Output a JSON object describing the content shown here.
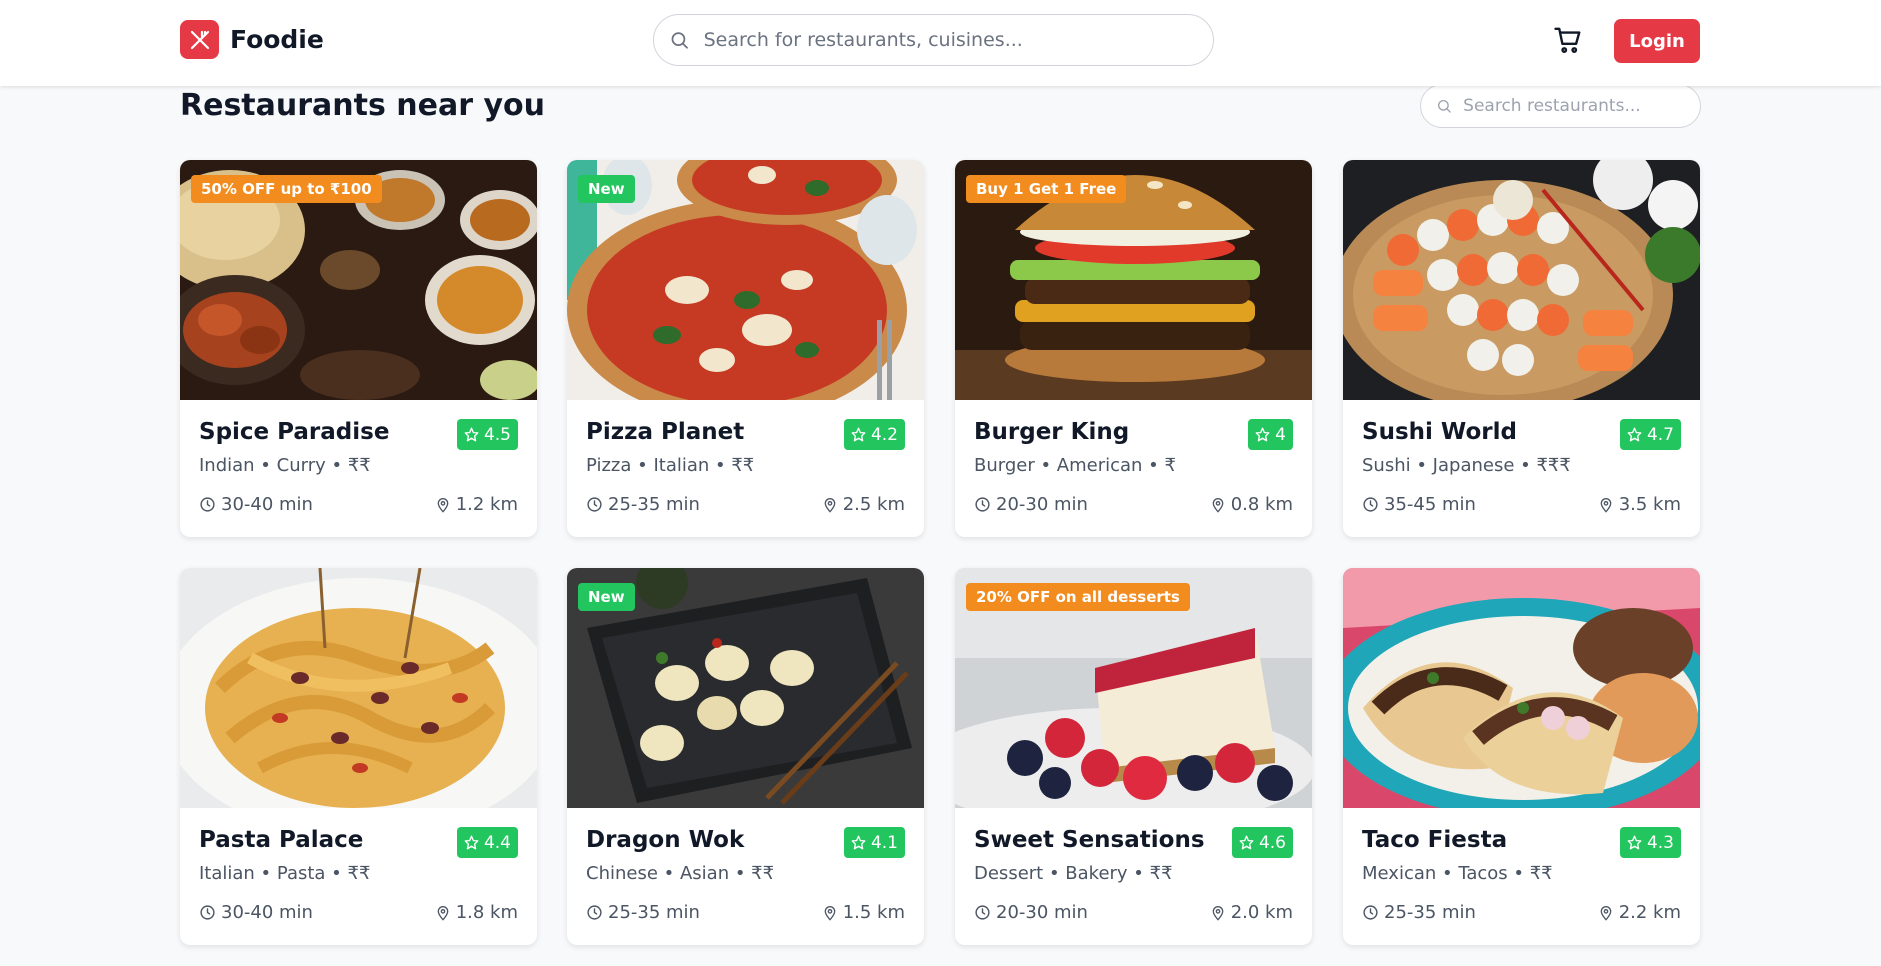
{
  "brand": {
    "name": "Foodie",
    "color": "#e63946"
  },
  "header": {
    "search_placeholder": "Search for restaurants, cuisines...",
    "cart_icon": "cart-icon",
    "login_label": "Login"
  },
  "section": {
    "title": "Restaurants near you",
    "search_placeholder": "Search restaurants..."
  },
  "colors": {
    "accent": "#e63946",
    "rating": "#22c55e",
    "offer_badge": "#f28c1f",
    "new_badge": "#22c55e"
  },
  "restaurants": [
    {
      "name": "Spice Paradise",
      "rating": "4.5",
      "cuisine": "Indian • Curry • ₹₹",
      "time": "30-40 min",
      "distance": "1.2 km",
      "badge": "50% OFF up to ₹100",
      "badge_type": "offer",
      "image": "indian-curry-spread"
    },
    {
      "name": "Pizza Planet",
      "rating": "4.2",
      "cuisine": "Pizza • Italian • ₹₹",
      "time": "25-35 min",
      "distance": "2.5 km",
      "badge": "New",
      "badge_type": "new",
      "image": "margherita-pizza"
    },
    {
      "name": "Burger King",
      "rating": "4",
      "cuisine": "Burger • American • ₹",
      "time": "20-30 min",
      "distance": "0.8 km",
      "badge": "Buy 1 Get 1 Free",
      "badge_type": "offer",
      "image": "burger"
    },
    {
      "name": "Sushi World",
      "rating": "4.7",
      "cuisine": "Sushi • Japanese • ₹₹₹",
      "time": "35-45 min",
      "distance": "3.5 km",
      "badge": "",
      "badge_type": "none",
      "image": "sushi-platter"
    },
    {
      "name": "Pasta Palace",
      "rating": "4.4",
      "cuisine": "Italian • Pasta • ₹₹",
      "time": "30-40 min",
      "distance": "1.8 km",
      "badge": "",
      "badge_type": "none",
      "image": "tagliatelle-pasta"
    },
    {
      "name": "Dragon Wok",
      "rating": "4.1",
      "cuisine": "Chinese • Asian • ₹₹",
      "time": "25-35 min",
      "distance": "1.5 km",
      "badge": "New",
      "badge_type": "new",
      "image": "dumplings"
    },
    {
      "name": "Sweet Sensations",
      "rating": "4.6",
      "cuisine": "Dessert • Bakery • ₹₹",
      "time": "20-30 min",
      "distance": "2.0 km",
      "badge": "20% OFF on all desserts",
      "badge_type": "offer",
      "image": "cheesecake-berries"
    },
    {
      "name": "Taco Fiesta",
      "rating": "4.3",
      "cuisine": "Mexican • Tacos • ₹₹",
      "time": "25-35 min",
      "distance": "2.2 km",
      "badge": "",
      "badge_type": "none",
      "image": "tacos"
    }
  ]
}
